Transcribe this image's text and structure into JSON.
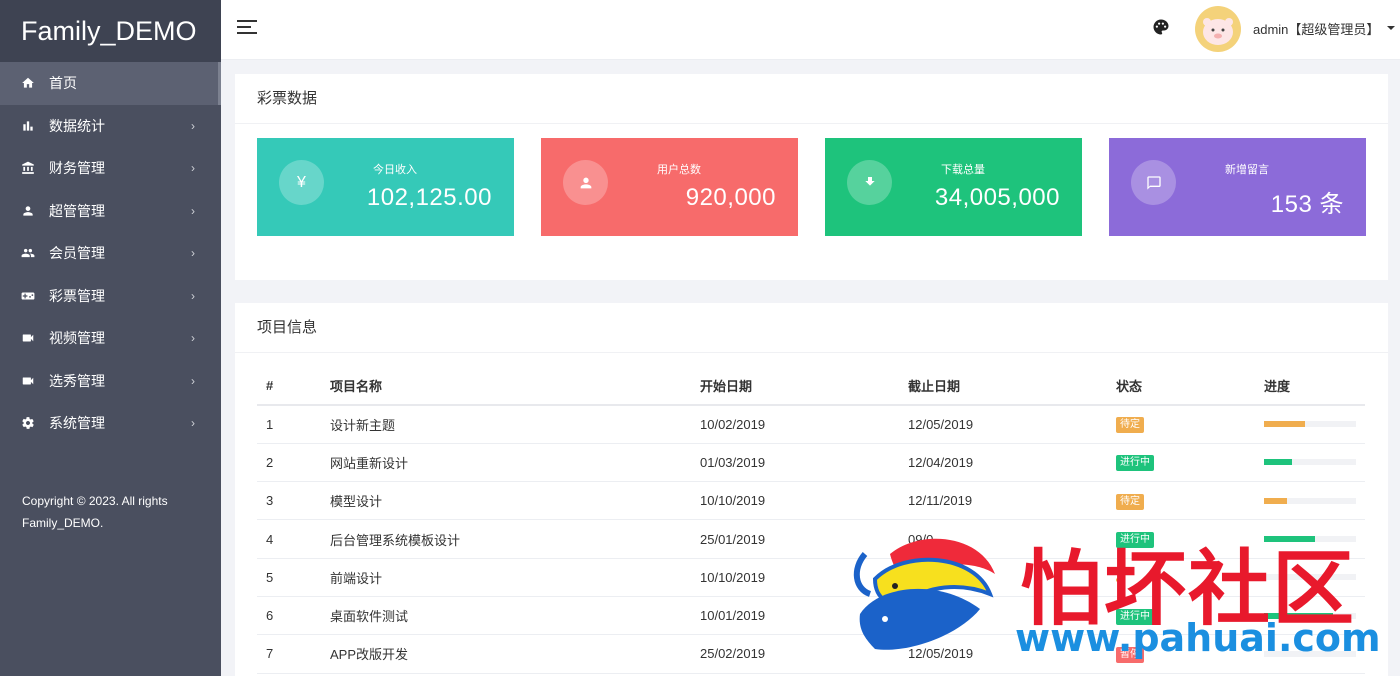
{
  "app": {
    "brand": "Family_DEMO"
  },
  "sidebar": {
    "items": [
      {
        "label": "首页",
        "icon": "home-icon",
        "active": true
      },
      {
        "label": "数据统计",
        "icon": "bar-chart-icon"
      },
      {
        "label": "财务管理",
        "icon": "bank-icon"
      },
      {
        "label": "超管管理",
        "icon": "user-icon"
      },
      {
        "label": "会员管理",
        "icon": "users-icon"
      },
      {
        "label": "彩票管理",
        "icon": "gamepad-icon"
      },
      {
        "label": "视频管理",
        "icon": "video-icon"
      },
      {
        "label": "选秀管理",
        "icon": "video-icon"
      },
      {
        "label": "系统管理",
        "icon": "gear-icon"
      }
    ],
    "chevron": "›",
    "copyright_line1": "Copyright © 2023. All rights",
    "copyright_line2": "Family_DEMO."
  },
  "header": {
    "user": "admin【超级管理员】"
  },
  "lottery": {
    "title": "彩票数据",
    "stats": [
      {
        "label": "今日收入",
        "value": "102,125.00",
        "color": "#35c9b8",
        "icon": "yen-icon",
        "glyph": "¥"
      },
      {
        "label": "用户总数",
        "value": "920,000",
        "color": "#f76b6b",
        "icon": "user-icon"
      },
      {
        "label": "下载总量",
        "value": "34,005,000",
        "color": "#1ec37c",
        "icon": "download-icon"
      },
      {
        "label": "新增留言",
        "value": "153 条",
        "color": "#8c6bd9",
        "icon": "message-icon"
      }
    ]
  },
  "projects": {
    "title": "项目信息",
    "columns": [
      "#",
      "项目名称",
      "开始日期",
      "截止日期",
      "状态",
      "进度"
    ],
    "rows": [
      {
        "num": "1",
        "name": "设计新主题",
        "start": "10/02/2019",
        "end": "12/05/2019",
        "status": "待定",
        "status_color": "#f0ad4e",
        "progress": 0.45,
        "progress_color": "#f0ad4e"
      },
      {
        "num": "2",
        "name": "网站重新设计",
        "start": "01/03/2019",
        "end": "12/04/2019",
        "status": "进行中",
        "status_color": "#1ec37c",
        "progress": 0.3,
        "progress_color": "#1ec37c"
      },
      {
        "num": "3",
        "name": "模型设计",
        "start": "10/10/2019",
        "end": "12/11/2019",
        "status": "待定",
        "status_color": "#f0ad4e",
        "progress": 0.25,
        "progress_color": "#f0ad4e"
      },
      {
        "num": "4",
        "name": "后台管理系统模板设计",
        "start": "25/01/2019",
        "end": "09/0",
        "status": "进行中",
        "status_color": "#1ec37c",
        "progress": 0.55,
        "progress_color": "#1ec37c"
      },
      {
        "num": "5",
        "name": "前端设计",
        "start": "10/10/2019",
        "end": "2/2019",
        "status": "",
        "status_color": "#f0ad4e",
        "progress": 0.0,
        "progress_color": "#f0ad4e"
      },
      {
        "num": "6",
        "name": "桌面软件测试",
        "start": "10/01/2019",
        "end": "19",
        "status": "进行中",
        "status_color": "#1ec37c",
        "progress": 0.75,
        "progress_color": "#1ec37c"
      },
      {
        "num": "7",
        "name": "APP改版开发",
        "start": "25/02/2019",
        "end": "12/05/2019",
        "status": "暂停",
        "status_color": "#f76b6b",
        "progress": 0.0,
        "progress_color": "#f76b6b"
      }
    ]
  },
  "watermark": {
    "cn": "怕坏社区",
    "url": "www.pahuai.com"
  }
}
